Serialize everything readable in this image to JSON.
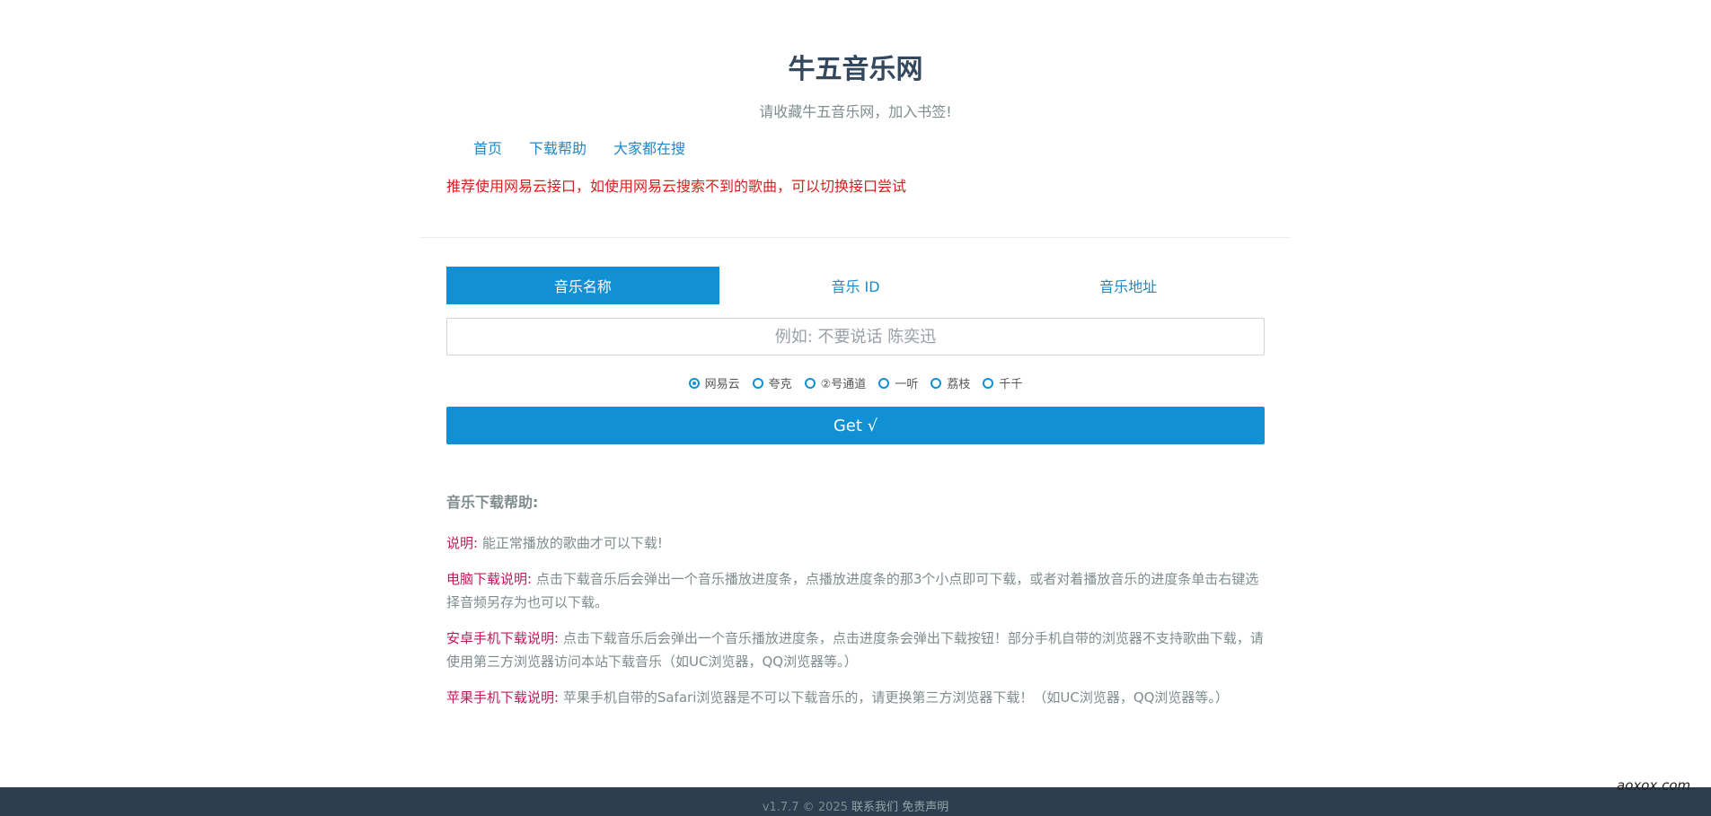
{
  "header": {
    "title": "牛五音乐网",
    "subtitle": "请收藏牛五音乐网，加入书签!"
  },
  "nav": {
    "items": [
      "首页",
      "下载帮助",
      "大家都在搜"
    ]
  },
  "notice": "推荐使用网易云接口，如使用网易云搜索不到的歌曲，可以切换接口尝试",
  "search": {
    "tabs": [
      "音乐名称",
      "音乐 ID",
      "音乐地址"
    ],
    "active_tab": "音乐名称",
    "placeholder": "例如: 不要说话 陈奕迅",
    "value": "",
    "sources": [
      "网易云",
      "夸克",
      "②号通道",
      "一听",
      "荔枝",
      "千千"
    ],
    "selected_source": "网易云",
    "submit_label": "Get √"
  },
  "help": {
    "title": "音乐下载帮助:",
    "items": [
      {
        "label": "说明:",
        "text": "能正常播放的歌曲才可以下载!"
      },
      {
        "label": "电脑下载说明:",
        "text": "点击下载音乐后会弹出一个音乐播放进度条，点播放进度条的那3个小点即可下载，或者对着播放音乐的进度条单击右键选择音频另存为也可以下载。"
      },
      {
        "label": "安卓手机下载说明:",
        "text": "点击下载音乐后会弹出一个音乐播放进度条，点击进度条会弹出下载按钮！部分手机自带的浏览器不支持歌曲下载，请使用第三方浏览器访问本站下载音乐（如UC浏览器，QQ浏览器等。）"
      },
      {
        "label": "苹果手机下载说明:",
        "text": "苹果手机自带的Safari浏览器是不可以下载音乐的，请更换第三方浏览器下载！（如UC浏览器，QQ浏览器等。）"
      }
    ]
  },
  "footer": {
    "version": "v1.7.7 © 2025",
    "contact": "联系我们",
    "disclaimer": "免责声明"
  },
  "watermark": "aoxox.com",
  "colors": {
    "accent": "#1190d4",
    "notice": "#d81e1e",
    "help_label": "#c2185b",
    "footer_bg": "#2c3e50"
  }
}
